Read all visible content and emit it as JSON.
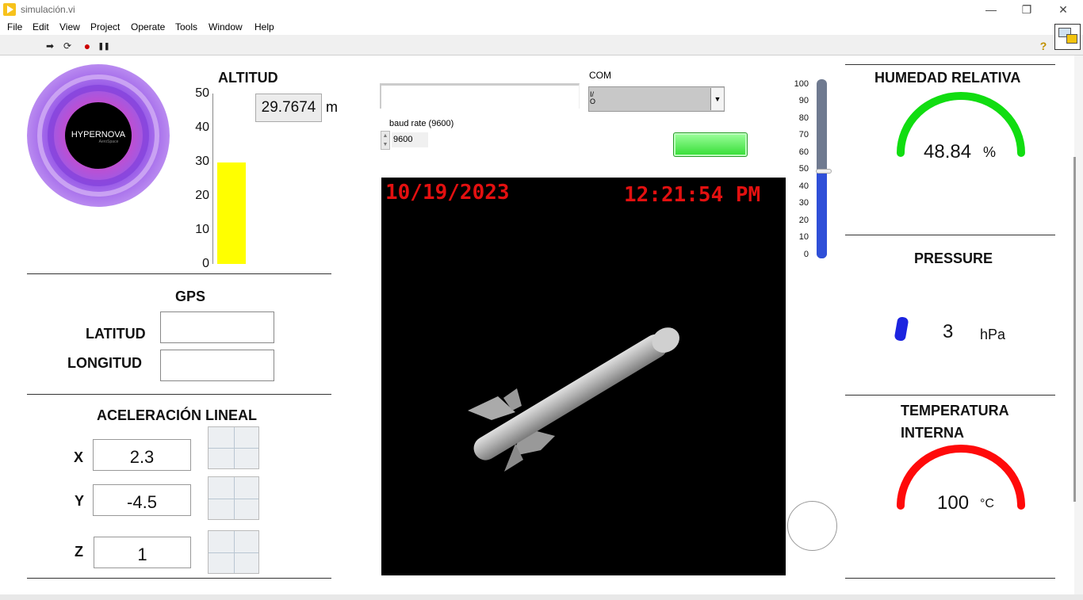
{
  "window": {
    "title": "simulación.vi",
    "minimize": "—",
    "restore": "❐",
    "close": "✕"
  },
  "menu": [
    "File",
    "Edit",
    "View",
    "Project",
    "Operate",
    "Tools",
    "Window",
    "Help"
  ],
  "toolbar": {
    "run": "➡",
    "run_continuous": "⟳",
    "abort": "●",
    "pause": "❚❚",
    "help": "?"
  },
  "altitud": {
    "title": "ALTITUD",
    "value": "29.7674",
    "unit": "m",
    "scale": [
      "50",
      "40",
      "30",
      "20",
      "10",
      "0"
    ],
    "level": 29.7674,
    "max": 50,
    "bar_color": "#ffff00"
  },
  "logo": {
    "text": "HYPERNOVA",
    "subtext": "AeroSpace"
  },
  "gps": {
    "title": "GPS",
    "lat_label": "LATITUD",
    "lon_label": "LONGITUD",
    "lat_value": "",
    "lon_value": ""
  },
  "accel": {
    "title": "ACELERACIÓN LINEAL",
    "x_label": "X",
    "y_label": "Y",
    "z_label": "Z",
    "x": "2.3",
    "y": "-4.5",
    "z": "1"
  },
  "serial": {
    "com_label": "COM",
    "com_value": "I/O",
    "baud_label": "baud rate (9600)",
    "baud_value": "9600",
    "message": ""
  },
  "display": {
    "date": "10/19/2023",
    "time": "12:21:54 PM",
    "text_color": "#e31010"
  },
  "slider": {
    "ticks": [
      "100",
      "90",
      "80",
      "70",
      "60",
      "50",
      "40",
      "30",
      "20",
      "10",
      "0"
    ],
    "value": 50,
    "fill_color": "#2f4fd8"
  },
  "humedad": {
    "title": "HUMEDAD RELATIVA",
    "value": "48.84",
    "unit": "%",
    "arc_color": "#11dd11"
  },
  "pressure": {
    "title": "PRESSURE",
    "value": "3",
    "unit": "hPa"
  },
  "temperatura": {
    "title_line1": "TEMPERATURA",
    "title_line2": "INTERNA",
    "value": "100",
    "unit": "°C",
    "arc_color": "#ff0a0a"
  }
}
